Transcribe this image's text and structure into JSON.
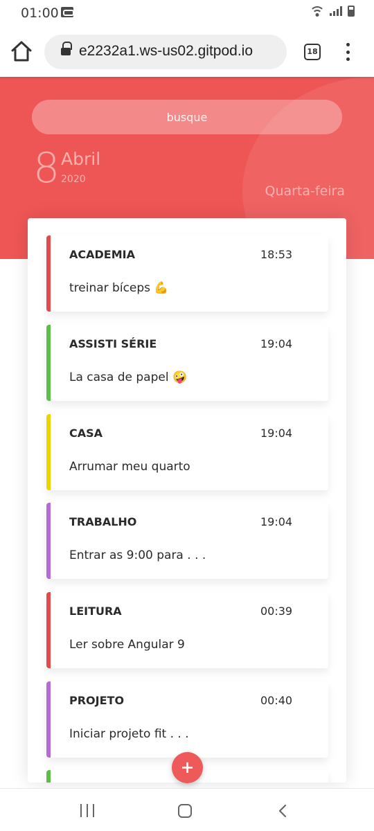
{
  "status_bar": {
    "time": "01:00",
    "icons": [
      "vm-icon",
      "wifi-icon",
      "signal-icon",
      "battery-icon"
    ]
  },
  "browser": {
    "url": "e2232a1.ws-us02.gitpod.io",
    "tab_count": "18",
    "icons": [
      "home-icon",
      "lock-icon",
      "tabs-icon",
      "more-vert-icon"
    ]
  },
  "header": {
    "search_placeholder": "busque",
    "day": "8",
    "month": "Abril",
    "year": "2020",
    "weekday": "Quarta-feira",
    "color": "#ee5655"
  },
  "tasks": [
    {
      "title": "ACADEMIA",
      "time": "18:53",
      "text": "treinar bíceps 💪",
      "color": "#e24b4b"
    },
    {
      "title": "ASSISTI SÉRIE",
      "time": "19:04",
      "text": "La casa de papel 🤪",
      "color": "#5bbf4a"
    },
    {
      "title": "CASA",
      "time": "19:04",
      "text": "Arrumar meu quarto",
      "color": "#ecd400"
    },
    {
      "title": "TRABALHO",
      "time": "19:04",
      "text": "Entrar as 9:00 para . . .",
      "color": "#b56bd6"
    },
    {
      "title": "LEITURA",
      "time": "00:39",
      "text": "Ler sobre Angular 9",
      "color": "#e24b4b"
    },
    {
      "title": "PROJETO",
      "time": "00:40",
      "text": "Iniciar projeto fit . . .",
      "color": "#b56bd6"
    },
    {
      "title": "",
      "time": "",
      "text": "",
      "color": "#5bbf4a"
    }
  ],
  "fab": {
    "label": "+"
  },
  "nav": {
    "icons": [
      "recent-apps-icon",
      "home-icon",
      "back-icon"
    ]
  }
}
